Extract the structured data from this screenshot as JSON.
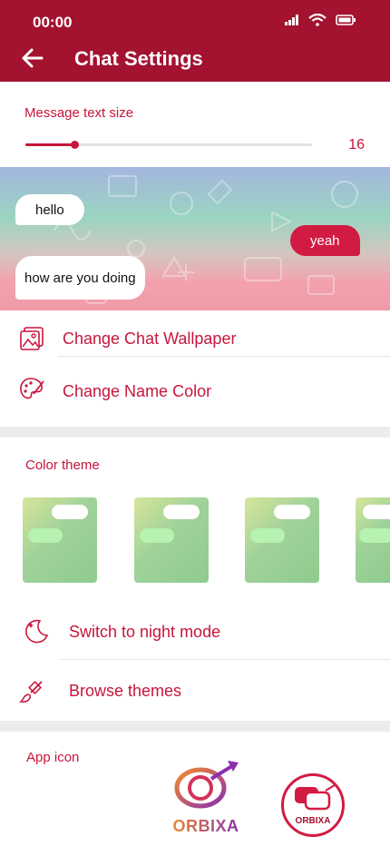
{
  "status": {
    "time": "00:00"
  },
  "header": {
    "title": "Chat Settings"
  },
  "text_size": {
    "label": "Message text size",
    "value": "16",
    "fraction": 0.17
  },
  "preview": {
    "messages": [
      {
        "text": "hello",
        "side": "in"
      },
      {
        "text": "yeah",
        "side": "out"
      },
      {
        "text": "how are you doing",
        "side": "in"
      }
    ]
  },
  "menu": {
    "wallpaper": "Change Chat Wallpaper",
    "name_color": "Change Name Color",
    "night_mode": "Switch to night mode",
    "browse_themes": "Browse themes"
  },
  "color_theme": {
    "label": "Color theme",
    "count": 4
  },
  "app_icon": {
    "label": "App icon",
    "brand": "ORBIXA"
  },
  "colors": {
    "accent": "#c8153b",
    "header": "#a3122f"
  }
}
